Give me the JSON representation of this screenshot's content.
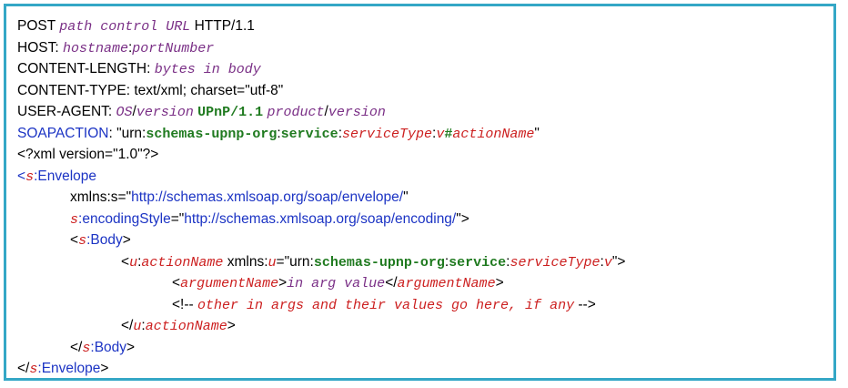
{
  "colors": {
    "border": "#34a7c6",
    "purple": "#7a2f86",
    "red": "#cc1f1f",
    "green": "#1f7a1f",
    "blue": "#1c34c4",
    "black": "#000000"
  },
  "lines": {
    "l1": {
      "a": "POST ",
      "b": "path control URL",
      "c": " HTTP/1.1"
    },
    "l2": {
      "a": "HOST: ",
      "b": "hostname",
      "c": ":",
      "d": "portNumber"
    },
    "l3": {
      "a": "CONTENT-LENGTH: ",
      "b": "bytes in body"
    },
    "l4": {
      "a": "CONTENT-TYPE: text/xml; charset=\"utf-8\""
    },
    "l5": {
      "a": "USER-AGENT: ",
      "b": "OS",
      "c": "/",
      "d": "version",
      "e": " ",
      "f": "UPnP/1.1",
      "g": " ",
      "h": "product",
      "i": "/",
      "j": "version"
    },
    "l6": {
      "a": "SOAPACTION",
      "b": ": \"",
      "c": "urn",
      "d": ":",
      "e": "schemas-upnp-org",
      "f": ":",
      "g": "service",
      "h": ":",
      "i": "serviceType",
      "j": ":",
      "k": "v",
      "l": "#",
      "m": "actionName",
      "n": "\""
    },
    "l7": {
      "a": "<?xml version=\"1.0\"?>"
    },
    "l8": {
      "a": "<",
      "b": "s",
      "c": ":",
      "d": "Envelope"
    },
    "l9": {
      "a": "xmlns",
      "b": ":",
      "c": "s",
      "d": "=\"",
      "e": "http://schemas.xmlsoap.org/soap/envelope/",
      "f": "\""
    },
    "l10": {
      "a": "s",
      "b": ":",
      "c": "encodingStyle",
      "d": "=\"",
      "e": "http://schemas.xmlsoap.org/soap/encoding/",
      "f": "\">"
    },
    "l11": {
      "a": "<",
      "b": "s",
      "c": ":",
      "d": "Body",
      "e": ">"
    },
    "l12": {
      "a": "<",
      "b": "u",
      "c": ":",
      "d": "actionName",
      "e": " xmlns",
      "f": ":",
      "g": "u",
      "h": "=\"",
      "i": "urn",
      "j": ":",
      "k": "schemas-upnp-org",
      "l": ":",
      "m": "service",
      "n": ":",
      "o": "serviceType",
      "p": ":",
      "q": "v",
      "r": "\">"
    },
    "l13": {
      "a": "<",
      "b": "argumentName",
      "c": ">",
      "d": "in arg value",
      "e": "</",
      "f": "argumentName",
      "g": ">"
    },
    "l14": {
      "a": "<!-- ",
      "b": "other in args and their values go here, if any",
      "c": " -->"
    },
    "l15": {
      "a": "</",
      "b": "u",
      "c": ":",
      "d": "actionName",
      "e": ">"
    },
    "l16": {
      "a": "</",
      "b": "s",
      "c": ":",
      "d": "Body",
      "e": ">"
    },
    "l17": {
      "a": "</",
      "b": "s",
      "c": ":",
      "d": "Envelope",
      "e": ">"
    }
  }
}
